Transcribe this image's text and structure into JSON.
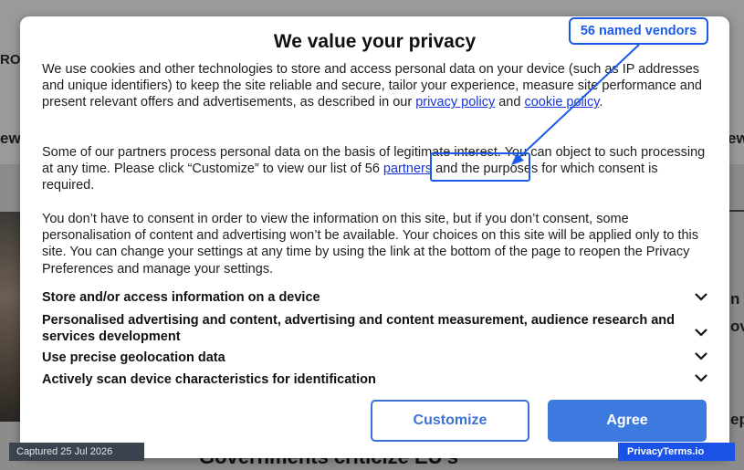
{
  "background": {
    "fragments": [
      "ROP",
      "ews",
      "ew",
      "n",
      "ov",
      "ep"
    ],
    "headline": "Governments criticize EU's"
  },
  "modal": {
    "title": "We value your privacy",
    "p1": {
      "text_a": "We use cookies and other technologies to store and access personal data on your device (such as IP addresses and unique identifiers) to keep the site reliable and secure, tailor your experience, measure site performance and present relevant offers and advertisements, as described in our ",
      "link_privacy": "privacy policy",
      "text_b": " and ",
      "link_cookie": "cookie policy",
      "text_c": "."
    },
    "p2": {
      "text_a": "Some of our partners process personal data on the basis of legitimate interest. You can object to such processing at any time. Please click “Customize” to view our list of 56 ",
      "link_partners": "partners",
      "text_b": " and the purposes for which consent is required."
    },
    "p3": "You don’t have to consent in order to view the information on this site, but if you don’t consent, some personalisation of content and advertising won’t be available. Your choices on this site will be applied only to this site. You can change your settings at any time by using the link at the bottom of the page to reopen the Privacy Preferences and manage your settings.",
    "purposes": [
      "Store and/or access information on a device",
      "Personalised advertising and content, advertising and content measurement, audience research and services development",
      "Use precise geolocation data",
      "Actively scan device characteristics for identification"
    ],
    "buttons": {
      "customize": "Customize",
      "agree": "Agree"
    }
  },
  "annotation": {
    "label": "56 named vendors",
    "color": "#1a5be8"
  },
  "footer": {
    "captured": "Captured 25 Jul 2026",
    "brand": "PrivacyTerms.io"
  },
  "colors": {
    "link": "#1a35d6",
    "button": "#3d7ae0",
    "brand_badge": "#1a52e8"
  }
}
